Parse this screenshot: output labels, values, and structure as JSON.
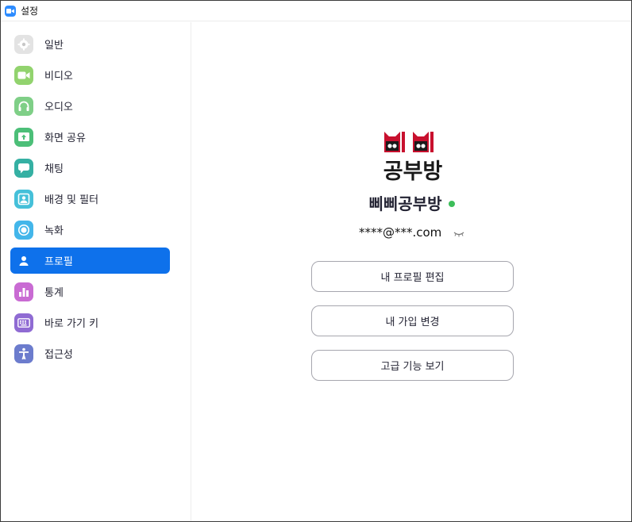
{
  "window": {
    "title": "설정"
  },
  "sidebar": {
    "items": [
      {
        "label": "일반",
        "icon": "gear-icon",
        "color": "#e0e0e0",
        "active": false
      },
      {
        "label": "비디오",
        "icon": "video-camera-icon",
        "color": "#92d36e",
        "active": false
      },
      {
        "label": "오디오",
        "icon": "headphones-icon",
        "color": "#7fcf87",
        "active": false
      },
      {
        "label": "화면 공유",
        "icon": "share-screen-icon",
        "color": "#4cbf78",
        "active": false
      },
      {
        "label": "채팅",
        "icon": "chat-bubble-icon",
        "color": "#35b0a3",
        "active": false
      },
      {
        "label": "배경 및 필터",
        "icon": "portrait-background-icon",
        "color": "#45c0d9",
        "active": false
      },
      {
        "label": "녹화",
        "icon": "record-icon",
        "color": "#43b6ea",
        "active": false
      },
      {
        "label": "프로필",
        "icon": "person-icon",
        "color": "#0e71eb",
        "active": true
      },
      {
        "label": "통계",
        "icon": "bar-chart-icon",
        "color": "#c96bd3",
        "active": false
      },
      {
        "label": "바로 가기 키",
        "icon": "keyboard-icon",
        "color": "#8f6bd3",
        "active": false
      },
      {
        "label": "접근성",
        "icon": "accessibility-icon",
        "color": "#6c7ccd",
        "active": false
      }
    ]
  },
  "profile": {
    "logo_text_top": "삐삐",
    "logo_text_bottom": "공부방",
    "name": "삐삐공부방",
    "email": "****@***.com",
    "status_color": "#3dbe5a"
  },
  "buttons": {
    "edit_profile": "내 프로필 편집",
    "change_plan": "내 가입 변경",
    "advanced": "고급 기능 보기"
  }
}
